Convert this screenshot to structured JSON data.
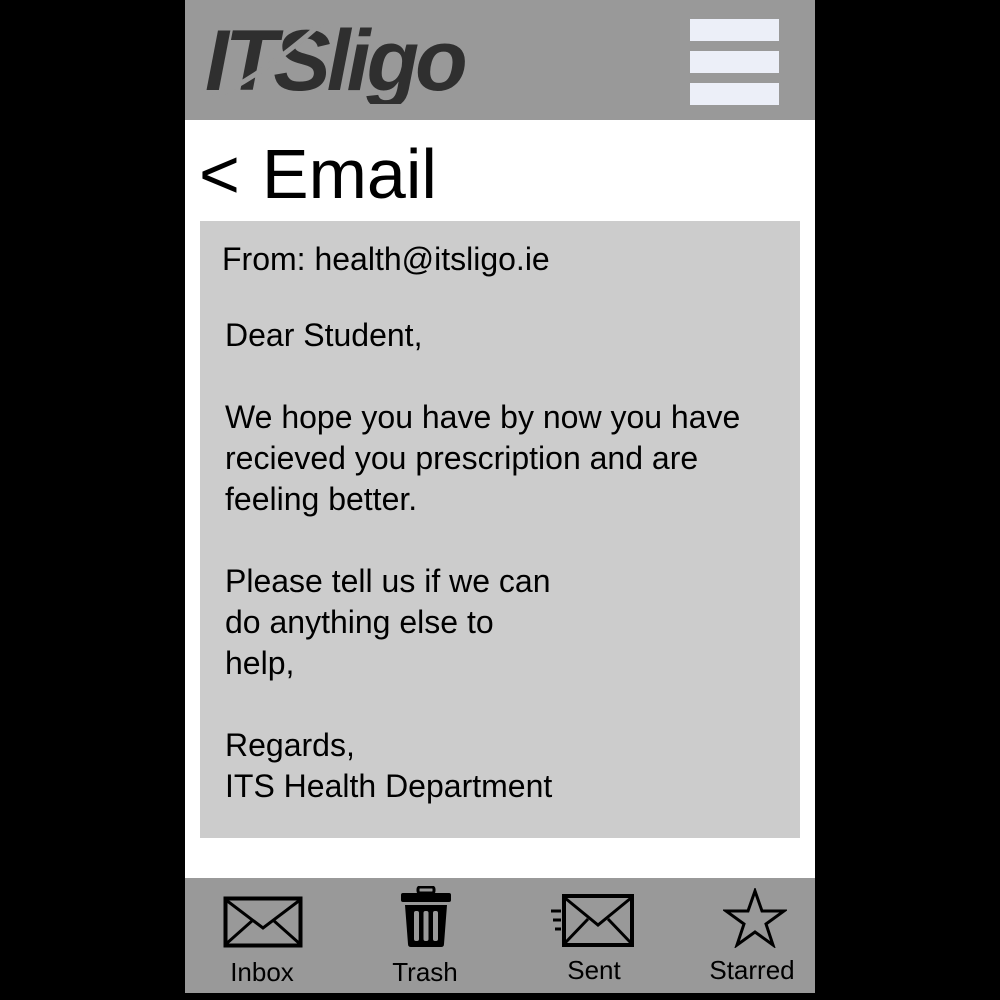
{
  "header": {
    "logo_text": "ITSligo",
    "menu_icon": "hamburger-menu-icon"
  },
  "nav": {
    "back_glyph": "<",
    "title": "Email"
  },
  "email": {
    "from_label": "From:",
    "from_address": "health@itsligo.ie",
    "body": {
      "greeting": "Dear Student,",
      "para1": [
        "We hope you have by now you have",
        "recieved you prescription and are",
        "feeling better."
      ],
      "para2": [
        "Please tell us if we can",
        "do anything else to",
        "help,"
      ],
      "closing": "Regards,",
      "signature": "ITS Health Department"
    }
  },
  "bottom_nav": {
    "items": [
      {
        "label": "Inbox",
        "icon": "envelope-icon"
      },
      {
        "label": "Trash",
        "icon": "trash-icon"
      },
      {
        "label": "Sent",
        "icon": "sent-envelope-icon"
      },
      {
        "label": "Starred",
        "icon": "star-icon"
      }
    ]
  },
  "colors": {
    "header_bg": "#999999",
    "card_bg": "#cccccc",
    "menu_bar": "#eceff8",
    "outer_bg": "#000000"
  }
}
